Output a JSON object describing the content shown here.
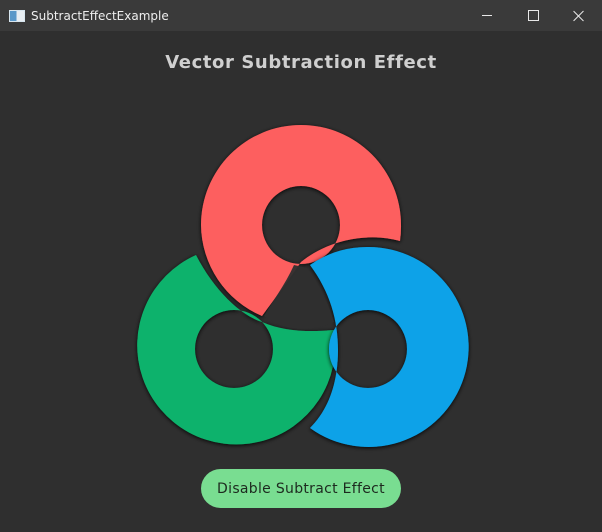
{
  "window": {
    "title": "SubtractEffectExample"
  },
  "heading": "Vector Subtraction Effect",
  "button": {
    "label": "Disable Subtract Effect"
  },
  "colors": {
    "red_ring": "#fd5f5f",
    "blue_ring": "#0ba2e8",
    "green_ring": "#0fb26c",
    "background": "#2f2f2f",
    "button": "#79dd91"
  },
  "icons": {
    "minimize": "minimize-icon",
    "maximize": "maximize-icon",
    "close": "close-icon"
  }
}
